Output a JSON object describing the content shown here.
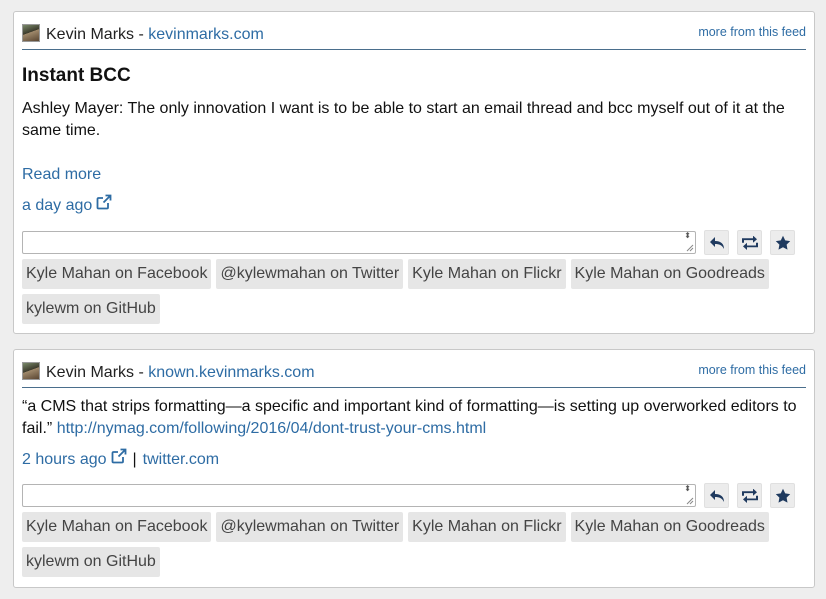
{
  "colors": {
    "link": "#2e6ca4",
    "card_bg": "#ffffff",
    "page_bg": "#eeeeee",
    "chip_bg": "#e6e6e6",
    "icon": "#1f3a5f"
  },
  "posts": [
    {
      "author_name": "Kevin Marks",
      "author_sep": " - ",
      "author_site": "kevinmarks.com",
      "more_label": "more from this feed",
      "title": "Instant BCC",
      "body": "Ashley Mayer: The only innovation I want is to be able to start an email thread and bcc myself out of it at the same time.",
      "read_more": "Read more",
      "time": "a day ago",
      "syndication": [
        "Kyle Mahan on Facebook",
        "@kylewmahan on Twitter",
        "Kyle Mahan on Flickr",
        "Kyle Mahan on Goodreads",
        "kylewm on GitHub"
      ]
    },
    {
      "author_name": "Kevin Marks",
      "author_sep": " - ",
      "author_site": "known.kevinmarks.com",
      "more_label": "more from this feed",
      "body": "“a CMS that strips formatting—a specific and important kind of formatting—is setting up overworked editors to fail.”",
      "body_link": "http://nymag.com/following/2016/04/dont-trust-your-cms.html",
      "time": "2 hours ago",
      "time_sep": "|",
      "source": "twitter.com",
      "syndication": [
        "Kyle Mahan on Facebook",
        "@kylewmahan on Twitter",
        "Kyle Mahan on Flickr",
        "Kyle Mahan on Goodreads",
        "kylewm on GitHub"
      ]
    }
  ],
  "icons": {
    "avatar": "avatar-photo",
    "external": "external-link-icon",
    "reply": "reply-icon",
    "repost": "repost-icon",
    "like": "star-icon"
  }
}
